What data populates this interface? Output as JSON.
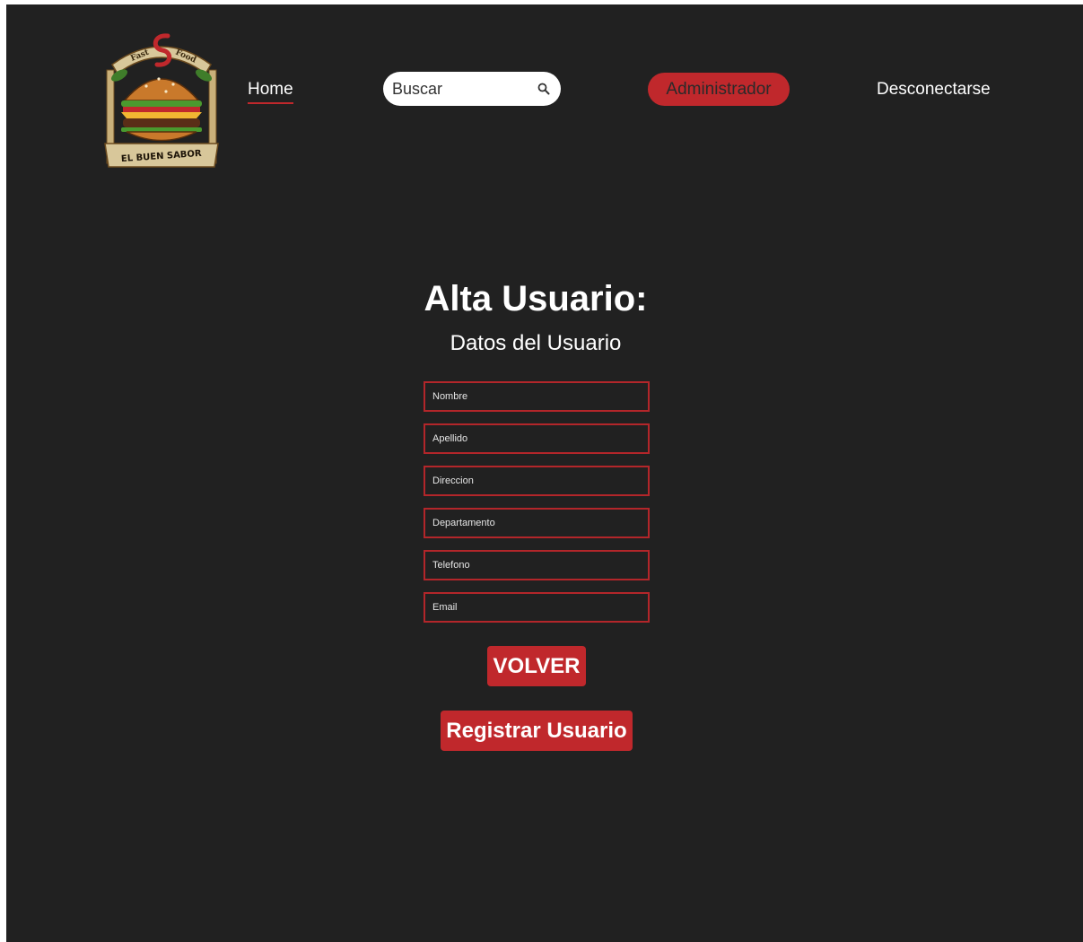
{
  "header": {
    "logo": {
      "top_text_left": "Fast",
      "top_text_right": "Food",
      "banner_text": "EL BUEN SABOR"
    },
    "nav_home": "Home",
    "search": {
      "placeholder": "Buscar",
      "value": "",
      "icon": "search-icon"
    },
    "admin_button": "Administrador",
    "logout": "Desconectarse"
  },
  "main": {
    "title": "Alta Usuario:",
    "subtitle": "Datos del Usuario",
    "fields": {
      "nombre": "Nombre",
      "apellido": "Apellido",
      "direccion": "Direccion",
      "departamento": "Departamento",
      "telefono": "Telefono",
      "email": "Email"
    },
    "back_button": "VOLVER",
    "register_button": "Registrar Usuario"
  },
  "colors": {
    "background": "#212121",
    "accent_red": "#c0282c",
    "text": "#ffffff"
  }
}
